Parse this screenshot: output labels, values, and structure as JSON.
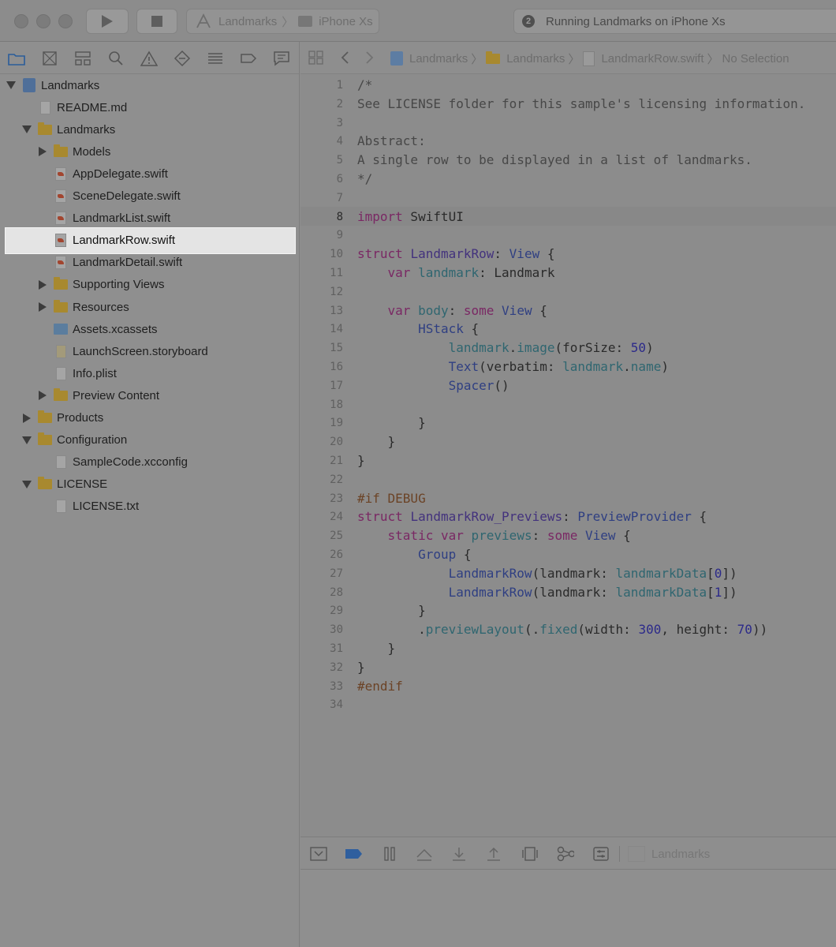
{
  "toolbar": {
    "scheme": "Landmarks",
    "destination": "iPhone Xs",
    "status_count": "2",
    "status": "Running Landmarks on iPhone Xs"
  },
  "navigator": {
    "tabs": [
      "folder-icon",
      "source-control-icon",
      "hierarchy-icon",
      "search-icon",
      "warning-icon",
      "test-icon",
      "debug-icon",
      "breakpoint-icon",
      "report-icon"
    ],
    "tree": [
      {
        "label": "Landmarks",
        "icon": "project",
        "depth": 0,
        "disclosure": "open"
      },
      {
        "label": "README.md",
        "icon": "doc",
        "depth": 1,
        "disclosure": "none"
      },
      {
        "label": "Landmarks",
        "icon": "folder",
        "depth": 1,
        "disclosure": "open"
      },
      {
        "label": "Models",
        "icon": "folder",
        "depth": 2,
        "disclosure": "closed"
      },
      {
        "label": "AppDelegate.swift",
        "icon": "swift",
        "depth": 2,
        "disclosure": "none"
      },
      {
        "label": "SceneDelegate.swift",
        "icon": "swift",
        "depth": 2,
        "disclosure": "none"
      },
      {
        "label": "LandmarkList.swift",
        "icon": "swift",
        "depth": 2,
        "disclosure": "none"
      },
      {
        "label": "LandmarkRow.swift",
        "icon": "swift",
        "depth": 2,
        "disclosure": "none",
        "selected": true
      },
      {
        "label": "LandmarkDetail.swift",
        "icon": "swift",
        "depth": 2,
        "disclosure": "none"
      },
      {
        "label": "Supporting Views",
        "icon": "folder",
        "depth": 2,
        "disclosure": "closed"
      },
      {
        "label": "Resources",
        "icon": "folder",
        "depth": 2,
        "disclosure": "closed"
      },
      {
        "label": "Assets.xcassets",
        "icon": "assets",
        "depth": 2,
        "disclosure": "none"
      },
      {
        "label": "LaunchScreen.storyboard",
        "icon": "storyboard",
        "depth": 2,
        "disclosure": "none"
      },
      {
        "label": "Info.plist",
        "icon": "plist",
        "depth": 2,
        "disclosure": "none"
      },
      {
        "label": "Preview Content",
        "icon": "folder",
        "depth": 2,
        "disclosure": "closed"
      },
      {
        "label": "Products",
        "icon": "folder",
        "depth": 1,
        "disclosure": "closed"
      },
      {
        "label": "Configuration",
        "icon": "folder",
        "depth": 1,
        "disclosure": "open"
      },
      {
        "label": "SampleCode.xcconfig",
        "icon": "config",
        "depth": 2,
        "disclosure": "none"
      },
      {
        "label": "LICENSE",
        "icon": "folder",
        "depth": 1,
        "disclosure": "open"
      },
      {
        "label": "LICENSE.txt",
        "icon": "doc",
        "depth": 2,
        "disclosure": "none"
      }
    ]
  },
  "jumpbar": {
    "crumbs": [
      "Landmarks",
      "Landmarks",
      "LandmarkRow.swift",
      "No Selection"
    ]
  },
  "editor": {
    "current_line": 8,
    "lines": [
      [
        [
          "cm",
          "/*"
        ]
      ],
      [
        [
          "cm",
          "See LICENSE folder for this sample's licensing information."
        ]
      ],
      [],
      [
        [
          "cm",
          "Abstract:"
        ]
      ],
      [
        [
          "cm",
          "A single row to be displayed in a list of landmarks."
        ]
      ],
      [
        [
          "cm",
          "*/"
        ]
      ],
      [],
      [
        [
          "kw",
          "import"
        ],
        [
          "p",
          " SwiftUI"
        ]
      ],
      [],
      [
        [
          "kw",
          "struct"
        ],
        [
          "p",
          " "
        ],
        [
          "ty",
          "LandmarkRow"
        ],
        [
          "p",
          ": "
        ],
        [
          "fn",
          "View"
        ],
        [
          "p",
          " {"
        ]
      ],
      [
        [
          "p",
          "    "
        ],
        [
          "kw",
          "var"
        ],
        [
          "p",
          " "
        ],
        [
          "id",
          "landmark"
        ],
        [
          "p",
          ": Landmark"
        ]
      ],
      [],
      [
        [
          "p",
          "    "
        ],
        [
          "kw",
          "var"
        ],
        [
          "p",
          " "
        ],
        [
          "id",
          "body"
        ],
        [
          "p",
          ": "
        ],
        [
          "kw",
          "some"
        ],
        [
          "p",
          " "
        ],
        [
          "fn",
          "View"
        ],
        [
          "p",
          " {"
        ]
      ],
      [
        [
          "p",
          "        "
        ],
        [
          "fn",
          "HStack"
        ],
        [
          "p",
          " {"
        ]
      ],
      [
        [
          "p",
          "            "
        ],
        [
          "id",
          "landmark"
        ],
        [
          "p",
          "."
        ],
        [
          "id",
          "image"
        ],
        [
          "p",
          "(forSize: "
        ],
        [
          "num",
          "50"
        ],
        [
          "p",
          ")"
        ]
      ],
      [
        [
          "p",
          "            "
        ],
        [
          "fn",
          "Text"
        ],
        [
          "p",
          "(verbatim: "
        ],
        [
          "id",
          "landmark"
        ],
        [
          "p",
          "."
        ],
        [
          "id",
          "name"
        ],
        [
          "p",
          ")"
        ]
      ],
      [
        [
          "p",
          "            "
        ],
        [
          "fn",
          "Spacer"
        ],
        [
          "p",
          "()"
        ]
      ],
      [],
      [
        [
          "p",
          "        }"
        ]
      ],
      [
        [
          "p",
          "    }"
        ]
      ],
      [
        [
          "p",
          "}"
        ]
      ],
      [],
      [
        [
          "pp",
          "#if DEBUG"
        ]
      ],
      [
        [
          "kw",
          "struct"
        ],
        [
          "p",
          " "
        ],
        [
          "ty",
          "LandmarkRow_Previews"
        ],
        [
          "p",
          ": "
        ],
        [
          "fn",
          "PreviewProvider"
        ],
        [
          "p",
          " {"
        ]
      ],
      [
        [
          "p",
          "    "
        ],
        [
          "kw",
          "static"
        ],
        [
          "p",
          " "
        ],
        [
          "kw",
          "var"
        ],
        [
          "p",
          " "
        ],
        [
          "id",
          "previews"
        ],
        [
          "p",
          ": "
        ],
        [
          "kw",
          "some"
        ],
        [
          "p",
          " "
        ],
        [
          "fn",
          "View"
        ],
        [
          "p",
          " {"
        ]
      ],
      [
        [
          "p",
          "        "
        ],
        [
          "fn",
          "Group"
        ],
        [
          "p",
          " {"
        ]
      ],
      [
        [
          "p",
          "            "
        ],
        [
          "fn",
          "LandmarkRow"
        ],
        [
          "p",
          "(landmark: "
        ],
        [
          "id",
          "landmarkData"
        ],
        [
          "p",
          "["
        ],
        [
          "num",
          "0"
        ],
        [
          "p",
          "])"
        ]
      ],
      [
        [
          "p",
          "            "
        ],
        [
          "fn",
          "LandmarkRow"
        ],
        [
          "p",
          "(landmark: "
        ],
        [
          "id",
          "landmarkData"
        ],
        [
          "p",
          "["
        ],
        [
          "num",
          "1"
        ],
        [
          "p",
          "])"
        ]
      ],
      [
        [
          "p",
          "        }"
        ]
      ],
      [
        [
          "p",
          "        ."
        ],
        [
          "id",
          "previewLayout"
        ],
        [
          "p",
          "(."
        ],
        [
          "id",
          "fixed"
        ],
        [
          "p",
          "(width: "
        ],
        [
          "num",
          "300"
        ],
        [
          "p",
          ", height: "
        ],
        [
          "num",
          "70"
        ],
        [
          "p",
          "))"
        ]
      ],
      [
        [
          "p",
          "    }"
        ]
      ],
      [
        [
          "p",
          "}"
        ]
      ],
      [
        [
          "pp",
          "#endif"
        ]
      ],
      []
    ]
  },
  "debugbar": {
    "target": "Landmarks"
  }
}
